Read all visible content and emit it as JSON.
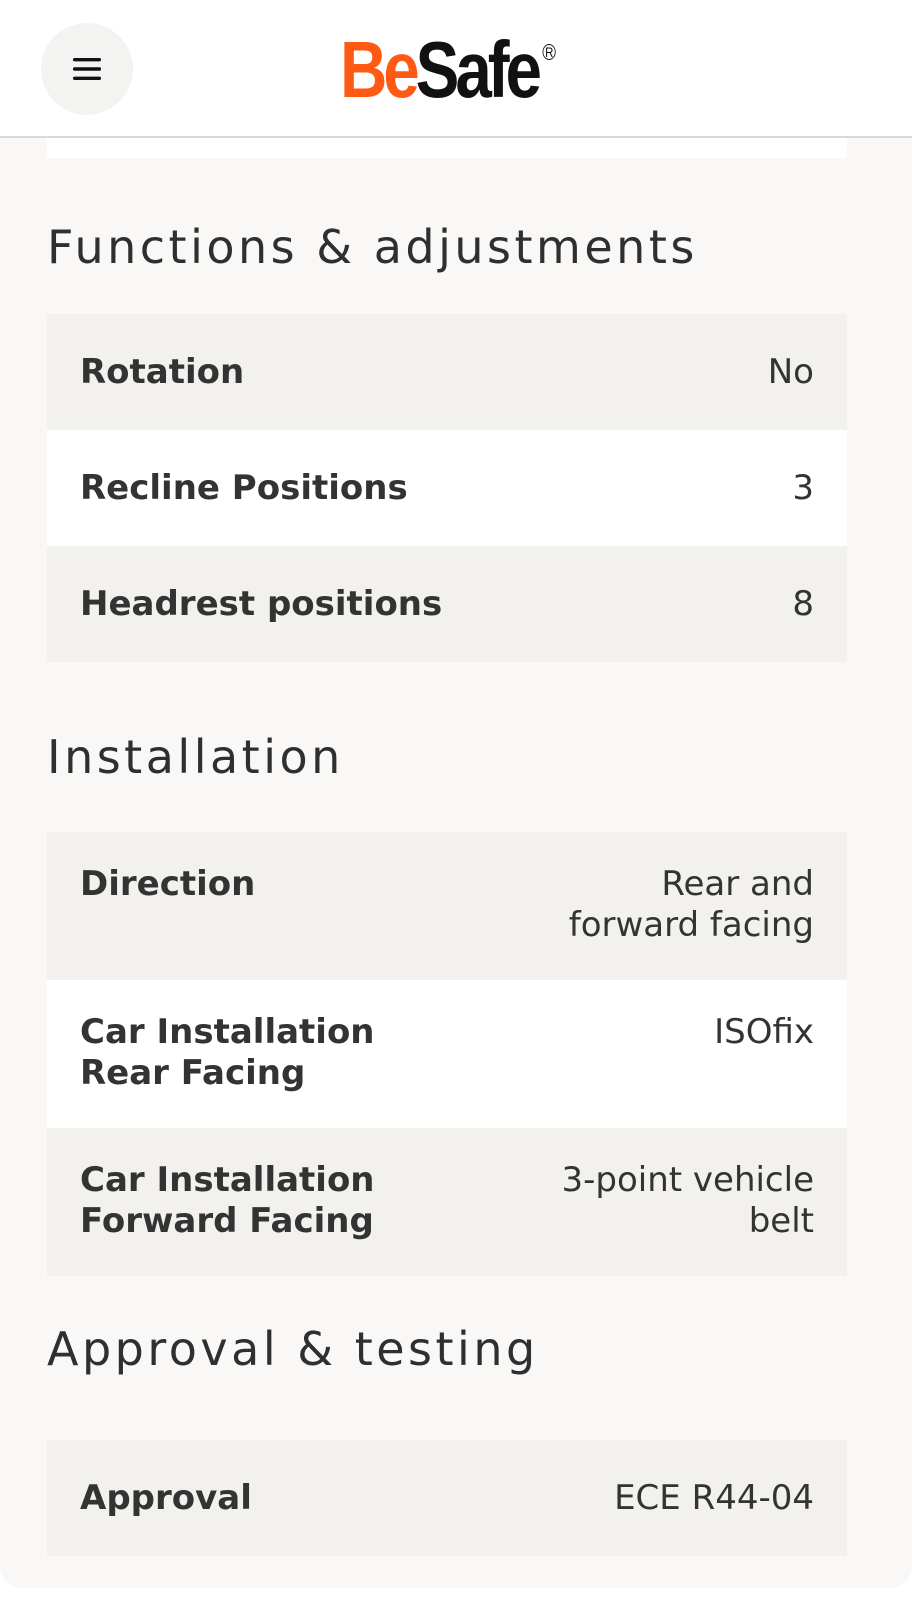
{
  "header": {
    "menu_icon": "hamburger-menu-icon",
    "logo": {
      "part1": "Be",
      "part2": "Safe",
      "registered": "R"
    },
    "colors": {
      "brand_orange": "#ff5a14",
      "brand_black": "#111111"
    }
  },
  "sections": [
    {
      "title": "Functions & adjustments",
      "rows": [
        {
          "label": "Rotation",
          "value": "No"
        },
        {
          "label": "Recline Positions",
          "value": "3"
        },
        {
          "label": "Headrest positions",
          "value": "8"
        }
      ]
    },
    {
      "title": "Installation",
      "rows": [
        {
          "label": "Direction",
          "value": "Rear and forward facing"
        },
        {
          "label": "Car Installation Rear Facing",
          "value": "ISOfix"
        },
        {
          "label": "Car Installation Forward Facing",
          "value": "3-point vehicle belt"
        }
      ]
    },
    {
      "title": "Approval & testing",
      "rows": [
        {
          "label": "Approval",
          "value": "ECE R44-04"
        }
      ]
    }
  ]
}
